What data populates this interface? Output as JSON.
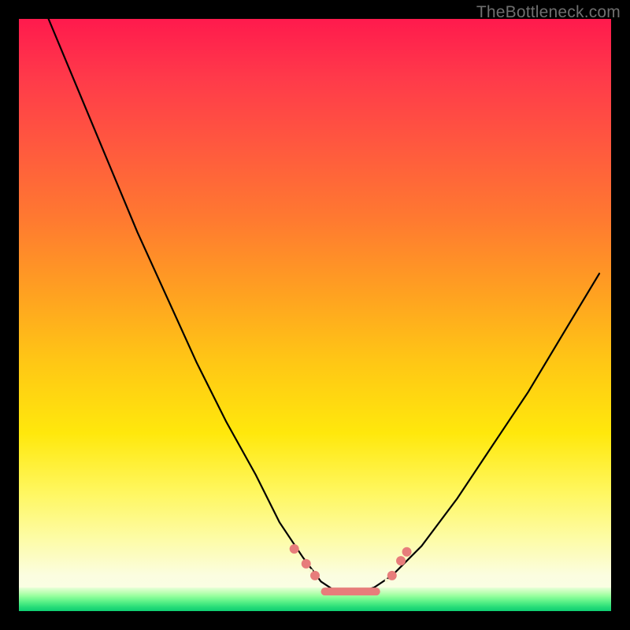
{
  "watermark": "TheBottleneck.com",
  "colors": {
    "frame": "#000000",
    "gradient_top": "#ff1a4d",
    "gradient_mid": "#ffe80c",
    "gradient_bottom_green": "#0fce72",
    "curve_stroke": "#000000",
    "marker_fill": "#e77d7b",
    "marker_highlight": "#f7f7d0"
  },
  "chart_data": {
    "type": "line",
    "title": "",
    "xlabel": "",
    "ylabel": "",
    "xlim": [
      0,
      100
    ],
    "ylim": [
      0,
      100
    ],
    "note": "V-shaped bottleneck curve. y ≈ 100 is red (bad), y ≈ 0 is green (balanced). Minimum around x ≈ 55; left branch is steeper than right.",
    "series": [
      {
        "name": "bottleneck-curve",
        "x": [
          5,
          10,
          15,
          20,
          25,
          30,
          35,
          40,
          44,
          48,
          51,
          54,
          57,
          60,
          63,
          68,
          74,
          80,
          86,
          92,
          98
        ],
        "y": [
          100,
          88,
          76,
          64,
          53,
          42,
          32,
          23,
          15,
          9,
          5,
          3,
          3,
          4,
          6,
          11,
          19,
          28,
          37,
          47,
          57
        ]
      }
    ],
    "markers": {
      "name": "highlight-dots",
      "points": [
        {
          "x": 46.5,
          "y": 10.5
        },
        {
          "x": 48.5,
          "y": 8.0
        },
        {
          "x": 50.0,
          "y": 6.0
        },
        {
          "x": 63.0,
          "y": 6.0
        },
        {
          "x": 64.5,
          "y": 8.5
        },
        {
          "x": 65.5,
          "y": 10.0
        }
      ],
      "bar": {
        "x0": 51,
        "x1": 61,
        "y": 3.3
      }
    }
  }
}
